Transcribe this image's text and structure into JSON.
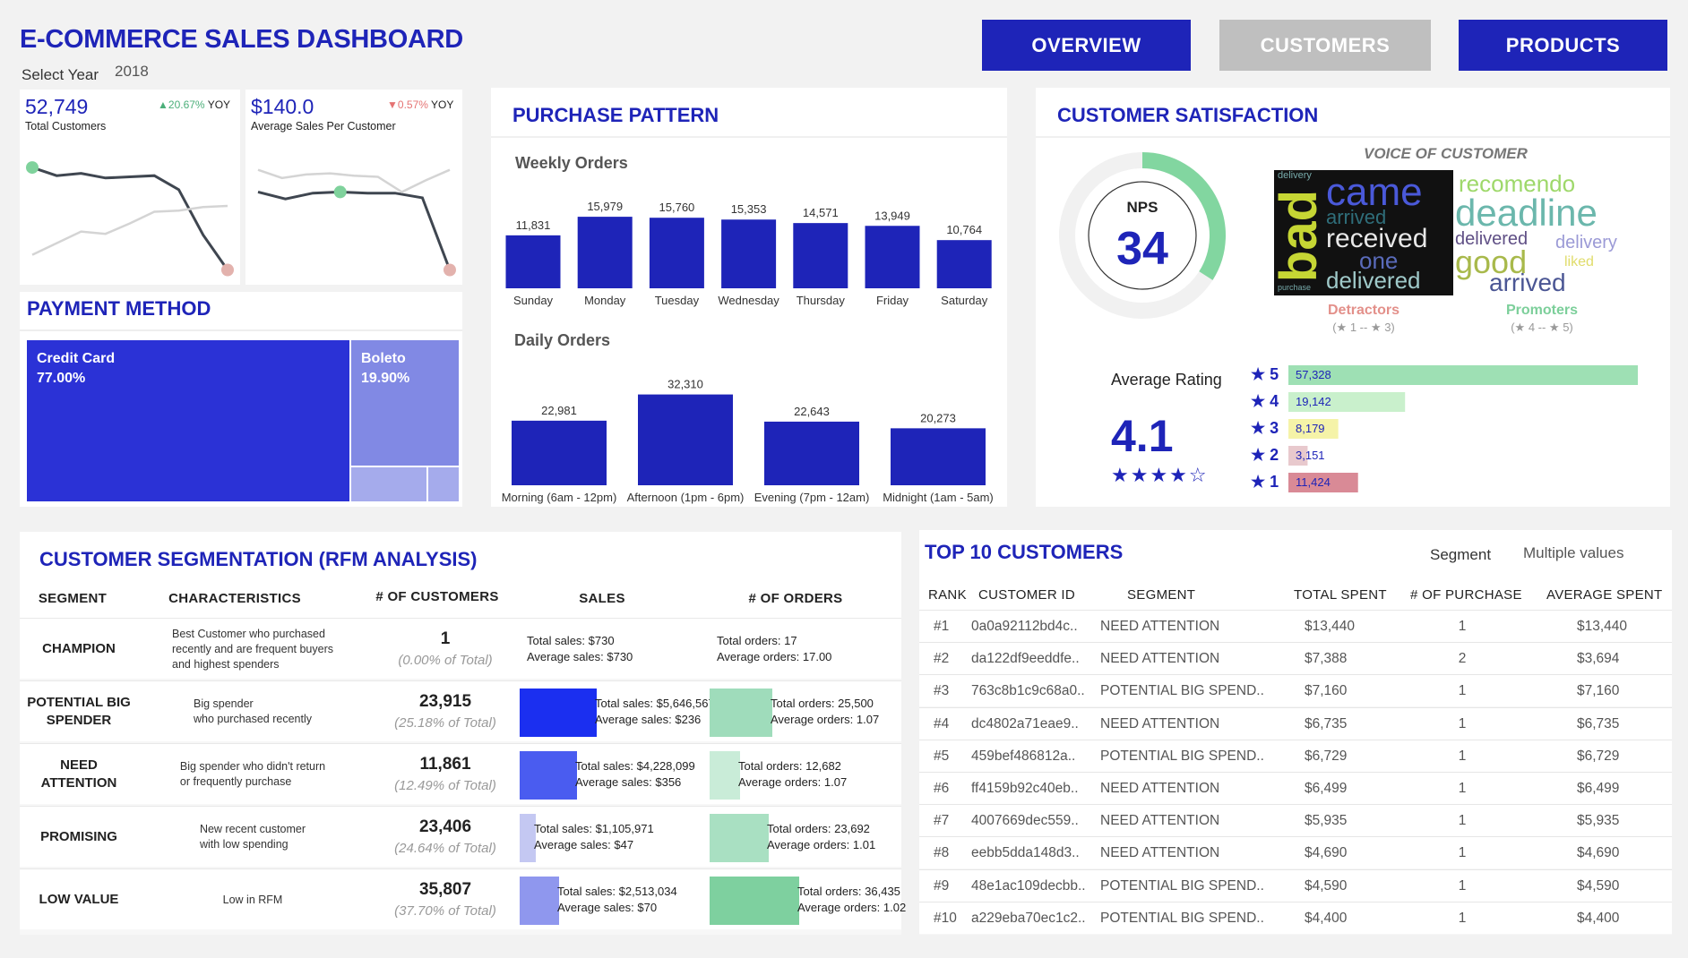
{
  "header": {
    "title": "E-COMMERCE SALES DASHBOARD",
    "select_year_label": "Select Year",
    "year": "2018"
  },
  "nav": {
    "overview": "OVERVIEW",
    "customers": "CUSTOMERS",
    "products": "PRODUCTS"
  },
  "kpi": {
    "customers": {
      "value": "52,749",
      "change": "20.67%",
      "yoy": "YOY",
      "label": "Total Customers"
    },
    "avg_sales": {
      "value": "$140.0",
      "change": "0.57%",
      "yoy": "YOY",
      "label": "Average Sales Per Customer"
    }
  },
  "payment": {
    "title": "PAYMENT METHOD",
    "items": [
      {
        "name": "Credit Card",
        "pct": "77.00%"
      },
      {
        "name": "Boleto",
        "pct": "19.90%"
      }
    ]
  },
  "purchase": {
    "title": "PURCHASE PATTERN",
    "weekly_title": "Weekly Orders",
    "daily_title": "Daily Orders"
  },
  "satisfaction": {
    "title": "CUSTOMER SATISFACTION",
    "nps_label": "NPS",
    "nps_value": "34",
    "voice_title": "VOICE OF CUSTOMER",
    "detractors": "Detractors",
    "detractors_range": "(★ 1 -- ★ 3)",
    "promoters": "Promoters",
    "promoters_range": "(★ 4 -- ★ 5)",
    "avg_label": "Average Rating",
    "avg_value": "4.1",
    "avg_stars": "★★★★☆",
    "words_left": [
      "bad",
      "came",
      "arrived",
      "received",
      "one",
      "delivered",
      "delivery",
      "purchase"
    ],
    "words_right": [
      "recomendo",
      "deadline",
      "delivered",
      "delivery",
      "good",
      "liked",
      "arrived"
    ]
  },
  "rfm": {
    "title": "CUSTOMER SEGMENTATION (RFM ANALYSIS)",
    "headers": [
      "SEGMENT",
      "CHARACTERISTICS",
      "# OF CUSTOMERS",
      "SALES",
      "# OF ORDERS"
    ],
    "rows": [
      {
        "segment": "CHAMPION",
        "characteristics": "Best Customer who purchased\nrecently and are frequent buyers\nand highest spenders",
        "count": "1",
        "pct": "(0.00% of Total)",
        "sales_total": "Total sales: $730",
        "sales_avg": "Average sales: $730",
        "orders_total": "Total orders: 17",
        "orders_avg": "Average orders: 17.00"
      },
      {
        "segment": "POTENTIAL BIG\nSPENDER",
        "characteristics": "Big spender\nwho purchased recently",
        "count": "23,915",
        "pct": "(25.18% of Total)",
        "sales_total": "Total sales: $5,646,567",
        "sales_avg": "Average sales: $236",
        "orders_total": "Total orders: 25,500",
        "orders_avg": "Average orders: 1.07"
      },
      {
        "segment": "NEED\nATTENTION",
        "characteristics": "Big spender who didn't return\nor frequently purchase",
        "count": "11,861",
        "pct": "(12.49% of Total)",
        "sales_total": "Total sales: $4,228,099",
        "sales_avg": "Average sales: $356",
        "orders_total": "Total orders: 12,682",
        "orders_avg": "Average orders: 1.07"
      },
      {
        "segment": "PROMISING",
        "characteristics": "New recent customer\nwith low spending",
        "count": "23,406",
        "pct": "(24.64% of Total)",
        "sales_total": "Total sales: $1,105,971",
        "sales_avg": "Average sales: $47",
        "orders_total": "Total orders: 23,692",
        "orders_avg": "Average orders: 1.01"
      },
      {
        "segment": "LOW VALUE",
        "characteristics": "Low in RFM",
        "count": "35,807",
        "pct": "(37.70% of Total)",
        "sales_total": "Total sales: $2,513,034",
        "sales_avg": "Average sales: $70",
        "orders_total": "Total orders: 36,435",
        "orders_avg": "Average orders: 1.02"
      }
    ]
  },
  "top10": {
    "title": "TOP 10 CUSTOMERS",
    "segment_label": "Segment",
    "segment_value": "Multiple values",
    "headers": [
      "RANK",
      "CUSTOMER ID",
      "SEGMENT",
      "TOTAL SPENT",
      "# OF PURCHASE",
      "AVERAGE SPENT"
    ],
    "rows": [
      [
        "#1",
        "0a0a92112bd4c..",
        "NEED ATTENTION",
        "$13,440",
        "1",
        "$13,440"
      ],
      [
        "#2",
        "da122df9eeddfe..",
        "NEED ATTENTION",
        "$7,388",
        "2",
        "$3,694"
      ],
      [
        "#3",
        "763c8b1c9c68a0..",
        "POTENTIAL BIG SPEND..",
        "$7,160",
        "1",
        "$7,160"
      ],
      [
        "#4",
        "dc4802a71eae9..",
        "NEED ATTENTION",
        "$6,735",
        "1",
        "$6,735"
      ],
      [
        "#5",
        "459bef486812a..",
        "POTENTIAL BIG SPEND..",
        "$6,729",
        "1",
        "$6,729"
      ],
      [
        "#6",
        "ff4159b92c40eb..",
        "NEED ATTENTION",
        "$6,499",
        "1",
        "$6,499"
      ],
      [
        "#7",
        "4007669dec559..",
        "NEED ATTENTION",
        "$5,935",
        "1",
        "$5,935"
      ],
      [
        "#8",
        "eebb5dda148d3..",
        "NEED ATTENTION",
        "$4,690",
        "1",
        "$4,690"
      ],
      [
        "#9",
        "48e1ac109decbb..",
        "POTENTIAL BIG SPEND..",
        "$4,590",
        "1",
        "$4,590"
      ],
      [
        "#10",
        "a229eba70ec1c2..",
        "POTENTIAL BIG SPEND..",
        "$4,400",
        "1",
        "$4,400"
      ]
    ]
  },
  "colors": {
    "primary": "#1e24b8",
    "promoter": "#82d6a0",
    "gray_btn": "#bfbfbf"
  },
  "chart_data": [
    {
      "type": "bar",
      "title": "Weekly Orders",
      "categories": [
        "Sunday",
        "Monday",
        "Tuesday",
        "Wednesday",
        "Thursday",
        "Friday",
        "Saturday"
      ],
      "values": [
        11831,
        15979,
        15760,
        15353,
        14571,
        13949,
        10764
      ],
      "labels": [
        "11,831",
        "15,979",
        "15,760",
        "15,353",
        "14,571",
        "13,949",
        "10,764"
      ],
      "ylim": [
        0,
        18000
      ]
    },
    {
      "type": "bar",
      "title": "Daily Orders",
      "categories": [
        "Morning (6am - 12pm)",
        "Afternoon (1pm - 6pm)",
        "Evening (7pm - 12am)",
        "Midnight (1am - 5am)"
      ],
      "values": [
        22981,
        32310,
        22643,
        20273
      ],
      "labels": [
        "22,981",
        "32,310",
        "22,643",
        "20,273"
      ],
      "ylim": [
        0,
        36000
      ]
    },
    {
      "type": "bar",
      "title": "Average Rating",
      "categories": [
        "★ 5",
        "★ 4",
        "★ 3",
        "★ 2",
        "★ 1"
      ],
      "values": [
        57328,
        19142,
        8179,
        3151,
        11424
      ],
      "labels": [
        "57,328",
        "19,142",
        "8,179",
        "3,151",
        "11,424"
      ],
      "colors": [
        "#9ee0b4",
        "#c9f0cc",
        "#f5f3a8",
        "#e8c9cd",
        "#d98a96"
      ]
    },
    {
      "type": "line",
      "series": [
        {
          "values": [
            0.93,
            0.86,
            0.88,
            0.84,
            0.85,
            0.86,
            0.74,
            0.35,
            0.05
          ]
        },
        {
          "values": [
            0.18,
            0.28,
            0.38,
            0.36,
            0.45,
            0.55,
            0.56,
            0.59,
            0.6
          ]
        }
      ],
      "ylim": [
        0,
        1
      ]
    },
    {
      "type": "line",
      "series": [
        {
          "values": [
            0.72,
            0.66,
            0.71,
            0.72,
            0.71,
            0.71,
            0.67,
            0.05
          ]
        },
        {
          "values": [
            0.91,
            0.84,
            0.87,
            0.88,
            0.86,
            0.85,
            0.72,
            0.82,
            0.91
          ]
        }
      ],
      "ylim": [
        0,
        1
      ]
    },
    {
      "type": "pie",
      "title": "NPS",
      "categories": [
        "NPS",
        "Remainder"
      ],
      "values": [
        34,
        66
      ]
    }
  ]
}
